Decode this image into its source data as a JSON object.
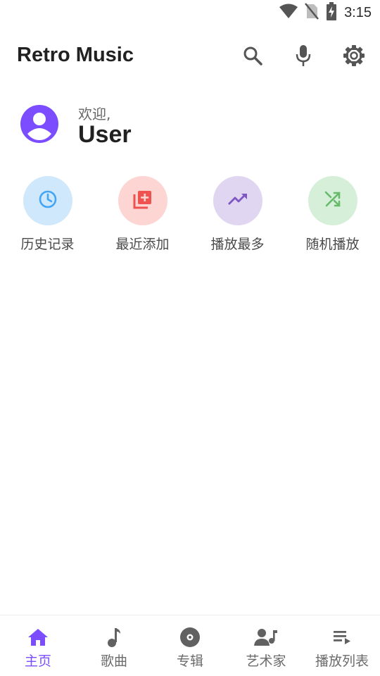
{
  "status_bar": {
    "time": "3:15",
    "icons": [
      "wifi-icon",
      "no-sim-icon",
      "battery-charging-icon"
    ]
  },
  "app_bar": {
    "title": "Retro Music",
    "actions": [
      {
        "name": "search-icon"
      },
      {
        "name": "mic-icon"
      },
      {
        "name": "settings-icon"
      }
    ]
  },
  "user": {
    "greeting": "欢迎,",
    "name": "User",
    "avatar_color": "#7c4dff"
  },
  "quick_actions": [
    {
      "label": "历史记录",
      "icon": "history-clock-icon",
      "bg": "#cfe8fb",
      "fg": "#42a5f5"
    },
    {
      "label": "最近添加",
      "icon": "library-add-icon",
      "bg": "#fdd5d2",
      "fg": "#ef5350"
    },
    {
      "label": "播放最多",
      "icon": "trending-up-icon",
      "bg": "#e0d6f2",
      "fg": "#7e57c2"
    },
    {
      "label": "随机播放",
      "icon": "shuffle-icon",
      "bg": "#d6efd9",
      "fg": "#66bb6a"
    }
  ],
  "bottom_nav": {
    "items": [
      {
        "label": "主页",
        "icon": "home-icon",
        "active": true
      },
      {
        "label": "歌曲",
        "icon": "music-note-icon",
        "active": false
      },
      {
        "label": "专辑",
        "icon": "album-icon",
        "active": false
      },
      {
        "label": "艺术家",
        "icon": "artist-icon",
        "active": false
      },
      {
        "label": "播放列表",
        "icon": "playlist-icon",
        "active": false
      }
    ]
  },
  "colors": {
    "accent": "#7c4dff",
    "inactive": "#6b6b6b"
  }
}
